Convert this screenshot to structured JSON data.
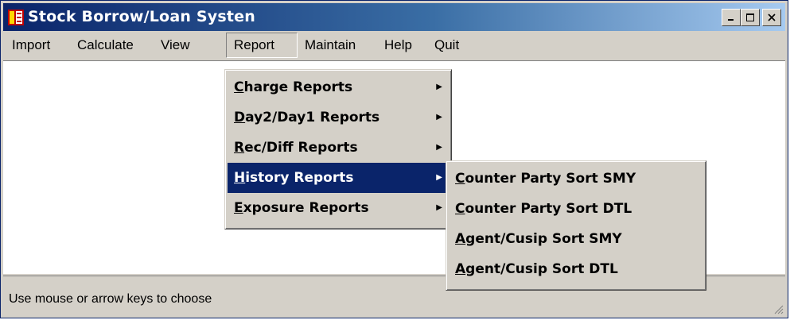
{
  "window": {
    "title": "Stock Borrow/Loan Systen",
    "controls": [
      "minimize-icon",
      "maximize-icon",
      "close-icon"
    ]
  },
  "menubar": {
    "items": [
      {
        "label": "Import"
      },
      {
        "label": "Calculate"
      },
      {
        "label": "View"
      },
      {
        "label": "Report",
        "active": true
      },
      {
        "label": "Maintain"
      },
      {
        "label": "Help"
      },
      {
        "label": "Quit"
      }
    ]
  },
  "report_menu": {
    "items": [
      {
        "mnemonic": "C",
        "rest": "harge Reports"
      },
      {
        "mnemonic": "D",
        "rest": "ay2/Day1 Reports"
      },
      {
        "mnemonic": "R",
        "rest": "ec/Diff Reports"
      },
      {
        "mnemonic": "H",
        "rest": "istory Reports",
        "highlighted": true
      },
      {
        "mnemonic": "E",
        "rest": "xposure Reports"
      }
    ]
  },
  "history_submenu": {
    "items": [
      {
        "mnemonic": "C",
        "rest": "ounter Party Sort SMY"
      },
      {
        "mnemonic": "C",
        "rest": "ounter Party Sort DTL"
      },
      {
        "mnemonic": "A",
        "rest": "gent/Cusip Sort SMY"
      },
      {
        "mnemonic": "A",
        "rest": "gent/Cusip Sort DTL"
      }
    ]
  },
  "statusbar": {
    "text": "Use mouse or arrow keys to choose"
  },
  "colors": {
    "title_start": "#0a246a",
    "title_end": "#a6caf0",
    "face": "#d4d0c8",
    "highlight": "#0a246a"
  }
}
